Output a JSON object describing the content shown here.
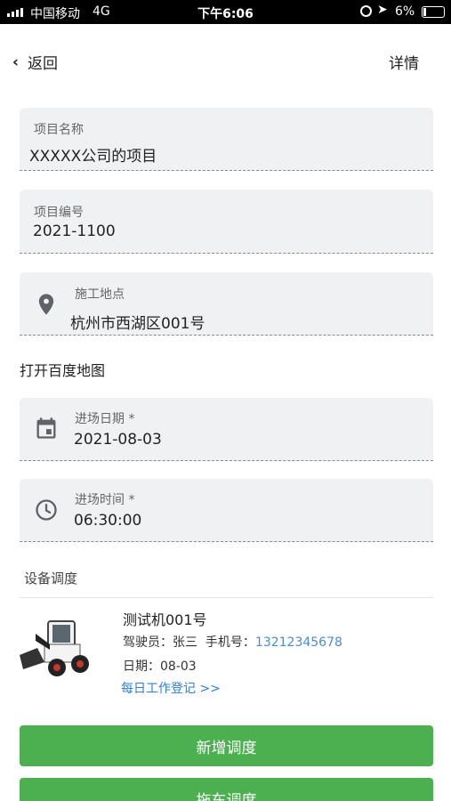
{
  "status_bar": {
    "carrier": "中国移动",
    "network": "4G",
    "time": "下午6:06",
    "battery": "6%"
  },
  "nav": {
    "back_label": "返回",
    "detail_label": "详情"
  },
  "form": {
    "project_name": {
      "label": "项目名称",
      "value": "XXXXX公司的项目"
    },
    "project_code": {
      "label": "项目编号",
      "value": "2021-1100"
    },
    "location": {
      "label": "施工地点",
      "value": "杭州市西湖区001号",
      "icon": "location-pin-icon"
    },
    "map_link": "打开百度地图",
    "entry_date": {
      "label": "进场日期 *",
      "value": "2021-08-03",
      "icon": "calendar-icon"
    },
    "entry_time": {
      "label": "进场时间 *",
      "value": "06:30:00",
      "icon": "clock-icon"
    }
  },
  "equipment": {
    "section_title": "设备调度",
    "items": [
      {
        "name": "测试机001号",
        "driver_label": "驾驶员：",
        "driver": "张三",
        "phone_label": "手机号：",
        "phone": "13212345678",
        "date_label": "日期：",
        "date": "08-03",
        "daily_link": "每日工作登记 >>",
        "thumbnail": "skid-steer-loader-image"
      }
    ]
  },
  "actions": {
    "add_dispatch": "新增调度",
    "second_button": "拖车调度"
  },
  "colors": {
    "primary_green": "#4caf50",
    "link_blue": "#2d7fd8",
    "field_bg": "#f0f1f3"
  }
}
